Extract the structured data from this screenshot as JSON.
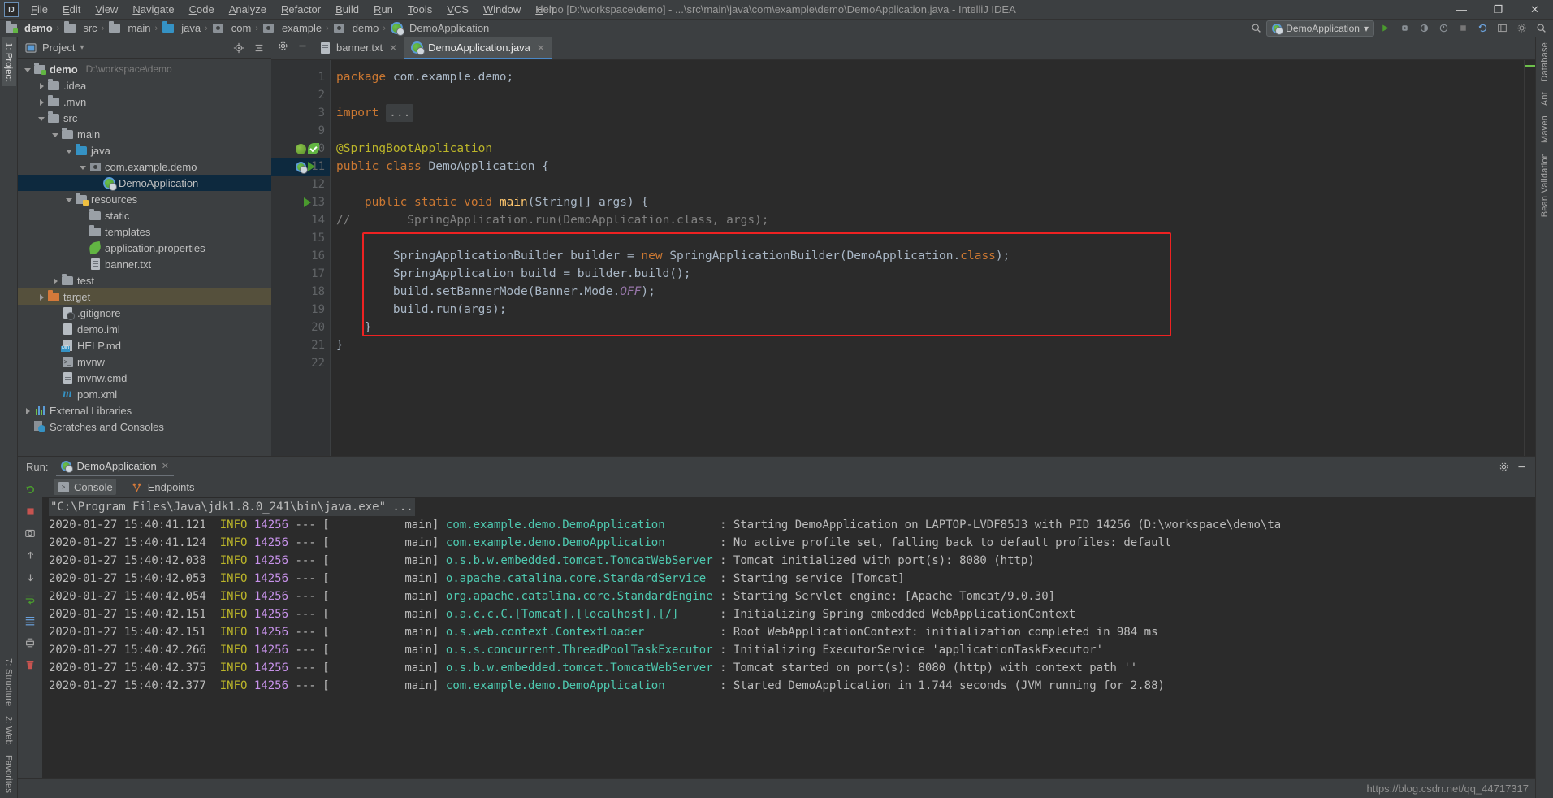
{
  "window": {
    "title": "demo [D:\\workspace\\demo] - ...\\src\\main\\java\\com\\example\\demo\\DemoApplication.java - IntelliJ IDEA",
    "logo": "IJ",
    "minimize": "—",
    "maximize": "❐",
    "close": "✕"
  },
  "menu": [
    {
      "label": "File"
    },
    {
      "label": "Edit"
    },
    {
      "label": "View"
    },
    {
      "label": "Navigate"
    },
    {
      "label": "Code"
    },
    {
      "label": "Analyze"
    },
    {
      "label": "Refactor"
    },
    {
      "label": "Build"
    },
    {
      "label": "Run"
    },
    {
      "label": "Tools"
    },
    {
      "label": "VCS"
    },
    {
      "label": "Window"
    },
    {
      "label": "Help"
    }
  ],
  "breadcrumb": {
    "separator": "›",
    "items": [
      {
        "label": "demo",
        "icon": "module-folder-icon"
      },
      {
        "label": "src",
        "icon": "folder-icon"
      },
      {
        "label": "main",
        "icon": "folder-icon"
      },
      {
        "label": "java",
        "icon": "source-folder-icon"
      },
      {
        "label": "com",
        "icon": "package-icon"
      },
      {
        "label": "example",
        "icon": "package-icon"
      },
      {
        "label": "demo",
        "icon": "package-icon"
      },
      {
        "label": "DemoApplication",
        "icon": "spring-class-icon"
      }
    ]
  },
  "toolbar": {
    "run_configuration": "DemoApplication",
    "dropdown_caret": "▾",
    "buttons": [
      {
        "name": "hammer-build-icon",
        "glyph": "⚒"
      },
      {
        "name": "run-icon",
        "glyph": "▶"
      },
      {
        "name": "debug-icon",
        "glyph": "⚙"
      },
      {
        "name": "run-coverage-icon",
        "glyph": "◐"
      },
      {
        "name": "profiler-icon",
        "glyph": "◴"
      },
      {
        "name": "stop-icon",
        "glyph": "■"
      },
      {
        "name": "search-everywhere-icon",
        "glyph": "⌕"
      },
      {
        "name": "update-project-icon",
        "glyph": "↻"
      },
      {
        "name": "settings-icon",
        "glyph": "⚙"
      },
      {
        "name": "layout-icon",
        "glyph": "▣"
      }
    ]
  },
  "project_pane": {
    "title": "Project",
    "caret": "▾",
    "tools": [
      {
        "name": "locate-in-tree-icon",
        "glyph": "⊕"
      },
      {
        "name": "collapse-all-icon",
        "glyph": "≡"
      },
      {
        "name": "settings-gear-icon",
        "glyph": "⚙"
      },
      {
        "name": "hide-panel-icon",
        "glyph": "—"
      }
    ],
    "tree": [
      {
        "label": "demo",
        "sub": "D:\\workspace\\demo",
        "indent": 0,
        "arrow": "down",
        "icon": "module-folder-icon",
        "bold": true,
        "state": "normal"
      },
      {
        "label": ".idea",
        "sub": "",
        "indent": 1,
        "arrow": "right",
        "icon": "folder-icon",
        "bold": false,
        "state": "normal"
      },
      {
        "label": ".mvn",
        "sub": "",
        "indent": 1,
        "arrow": "right",
        "icon": "folder-icon",
        "bold": false,
        "state": "normal"
      },
      {
        "label": "src",
        "sub": "",
        "indent": 1,
        "arrow": "down",
        "icon": "folder-icon",
        "bold": false,
        "state": "normal"
      },
      {
        "label": "main",
        "sub": "",
        "indent": 2,
        "arrow": "down",
        "icon": "folder-icon",
        "bold": false,
        "state": "normal"
      },
      {
        "label": "java",
        "sub": "",
        "indent": 3,
        "arrow": "down",
        "icon": "source-folder-icon",
        "bold": false,
        "state": "normal"
      },
      {
        "label": "com.example.demo",
        "sub": "",
        "indent": 4,
        "arrow": "down",
        "icon": "package-icon",
        "bold": false,
        "state": "normal"
      },
      {
        "label": "DemoApplication",
        "sub": "",
        "indent": 5,
        "arrow": "none",
        "icon": "spring-class-icon",
        "bold": false,
        "state": "selected"
      },
      {
        "label": "resources",
        "sub": "",
        "indent": 3,
        "arrow": "down",
        "icon": "resources-folder-icon",
        "bold": false,
        "state": "normal"
      },
      {
        "label": "static",
        "sub": "",
        "indent": 4,
        "arrow": "none",
        "icon": "folder-icon",
        "bold": false,
        "state": "normal"
      },
      {
        "label": "templates",
        "sub": "",
        "indent": 4,
        "arrow": "none",
        "icon": "folder-icon",
        "bold": false,
        "state": "normal"
      },
      {
        "label": "application.properties",
        "sub": "",
        "indent": 4,
        "arrow": "none",
        "icon": "spring-properties-icon",
        "bold": false,
        "state": "normal"
      },
      {
        "label": "banner.txt",
        "sub": "",
        "indent": 4,
        "arrow": "none",
        "icon": "text-file-icon",
        "bold": false,
        "state": "normal"
      },
      {
        "label": "test",
        "sub": "",
        "indent": 2,
        "arrow": "right",
        "icon": "folder-icon",
        "bold": false,
        "state": "normal"
      },
      {
        "label": "target",
        "sub": "",
        "indent": 1,
        "arrow": "right",
        "icon": "excluded-folder-icon",
        "bold": false,
        "state": "highlight"
      },
      {
        "label": ".gitignore",
        "sub": "",
        "indent": 2,
        "arrow": "none",
        "icon": "gitignore-file-icon",
        "bold": false,
        "state": "normal"
      },
      {
        "label": "demo.iml",
        "sub": "",
        "indent": 2,
        "arrow": "none",
        "icon": "iml-file-icon",
        "bold": false,
        "state": "normal"
      },
      {
        "label": "HELP.md",
        "sub": "",
        "indent": 2,
        "arrow": "none",
        "icon": "markdown-file-icon",
        "bold": false,
        "state": "normal"
      },
      {
        "label": "mvnw",
        "sub": "",
        "indent": 2,
        "arrow": "none",
        "icon": "shell-script-icon",
        "bold": false,
        "state": "normal"
      },
      {
        "label": "mvnw.cmd",
        "sub": "",
        "indent": 2,
        "arrow": "none",
        "icon": "text-file-icon",
        "bold": false,
        "state": "normal"
      },
      {
        "label": "pom.xml",
        "sub": "",
        "indent": 2,
        "arrow": "none",
        "icon": "maven-pom-icon",
        "bold": false,
        "state": "normal"
      },
      {
        "label": "External Libraries",
        "sub": "",
        "indent": 0,
        "arrow": "right",
        "icon": "libraries-icon",
        "bold": false,
        "state": "normal"
      },
      {
        "label": "Scratches and Consoles",
        "sub": "",
        "indent": 0,
        "arrow": "none",
        "icon": "scratches-icon",
        "bold": false,
        "state": "normal"
      }
    ]
  },
  "editor": {
    "tabs": [
      {
        "label": "banner.txt",
        "icon": "text-file-icon",
        "active": false,
        "close": "✕"
      },
      {
        "label": "DemoApplication.java",
        "icon": "spring-class-icon",
        "active": true,
        "close": "✕"
      }
    ],
    "gutter_tools": {
      "gear": "⚙",
      "minimize": "—"
    },
    "lines": [
      {
        "num": "1",
        "html": "<span class=\"kw\">package</span> com.example.demo;"
      },
      {
        "num": "2",
        "html": ""
      },
      {
        "num": "3",
        "html": "<span class=\"kw\">import</span> <span class=\"fold\">...</span>"
      },
      {
        "num": "9",
        "html": ""
      },
      {
        "num": "10",
        "html": "<span class=\"ann\">@SpringBootApplication</span>"
      },
      {
        "num": "11",
        "html": "<span class=\"kw\">public</span> <span class=\"kw\">class</span> DemoApplication {"
      },
      {
        "num": "12",
        "html": ""
      },
      {
        "num": "13",
        "html": "    <span class=\"kw\">public</span> <span class=\"kw\">static</span> <span class=\"kw\">void</span> <span class=\"mth\">main</span>(String[] args) {"
      },
      {
        "num": "14",
        "html": "<span class=\"cmt\">//        SpringApplication.run(DemoApplication.class, args);</span>"
      },
      {
        "num": "15",
        "html": ""
      },
      {
        "num": "16",
        "html": "        SpringApplicationBuilder builder = <span class=\"kw\">new</span> SpringApplicationBuilder(DemoApplication.<span class=\"kw\">class</span>);"
      },
      {
        "num": "17",
        "html": "        SpringApplication build = builder.build();"
      },
      {
        "num": "18",
        "html": "        build.setBannerMode(Banner.Mode.<span class=\"stc\">OFF</span>);"
      },
      {
        "num": "19",
        "html": "        build.run(args);"
      },
      {
        "num": "20",
        "html": "    }"
      },
      {
        "num": "21",
        "html": "}"
      },
      {
        "num": "22",
        "html": ""
      }
    ],
    "plain_lines": [
      "package com.example.demo;",
      "",
      "import ...",
      "",
      "@SpringBootApplication",
      "public class DemoApplication {",
      "",
      "    public static void main(String[] args) {",
      "//        SpringApplication.run(DemoApplication.class, args);",
      "",
      "        SpringApplicationBuilder builder = new SpringApplicationBuilder(DemoApplication.class);",
      "        SpringApplication build = builder.build();",
      "        build.setBannerMode(Banner.Mode.OFF);",
      "        build.run(args);",
      "    }",
      "}",
      ""
    ],
    "highlight_color": "#ee2222"
  },
  "run_panel": {
    "label": "Run:",
    "tab_title": "DemoApplication",
    "tab_close": "✕",
    "settings_icon": "⚙",
    "hide_icon": "—",
    "tabs": [
      {
        "label": "Console",
        "icon": "console-icon",
        "active": true
      },
      {
        "label": "Endpoints",
        "icon": "endpoints-icon",
        "active": false
      }
    ],
    "side_buttons": [
      {
        "name": "rerun-icon",
        "glyph": "↻"
      },
      {
        "name": "stop-icon",
        "glyph": "■"
      },
      {
        "name": "camera-icon",
        "glyph": "◱"
      },
      {
        "name": "up-icon",
        "glyph": "↑"
      },
      {
        "name": "down-icon",
        "glyph": "↓"
      },
      {
        "name": "soft-wrap-icon",
        "glyph": "↵"
      },
      {
        "name": "scroll-to-end-icon",
        "glyph": "↧"
      },
      {
        "name": "print-icon",
        "glyph": "⎙"
      },
      {
        "name": "clear-all-icon",
        "glyph": "🗑"
      }
    ],
    "command_line": "\"C:\\Program Files\\Java\\jdk1.8.0_241\\bin\\java.exe\" ...",
    "log": [
      {
        "date": "2020-01-27 15:40:41.121",
        "level": "INFO",
        "pid": "14256",
        "sep": "---",
        "thread": "main",
        "logger": "com.example.demo.DemoApplication",
        "message": "Starting DemoApplication on LAPTOP-LVDF85J3 with PID 14256 (D:\\workspace\\demo\\ta"
      },
      {
        "date": "2020-01-27 15:40:41.124",
        "level": "INFO",
        "pid": "14256",
        "sep": "---",
        "thread": "main",
        "logger": "com.example.demo.DemoApplication",
        "message": "No active profile set, falling back to default profiles: default"
      },
      {
        "date": "2020-01-27 15:40:42.038",
        "level": "INFO",
        "pid": "14256",
        "sep": "---",
        "thread": "main",
        "logger": "o.s.b.w.embedded.tomcat.TomcatWebServer",
        "message": "Tomcat initialized with port(s): 8080 (http)"
      },
      {
        "date": "2020-01-27 15:40:42.053",
        "level": "INFO",
        "pid": "14256",
        "sep": "---",
        "thread": "main",
        "logger": "o.apache.catalina.core.StandardService",
        "message": "Starting service [Tomcat]"
      },
      {
        "date": "2020-01-27 15:40:42.054",
        "level": "INFO",
        "pid": "14256",
        "sep": "---",
        "thread": "main",
        "logger": "org.apache.catalina.core.StandardEngine",
        "message": "Starting Servlet engine: [Apache Tomcat/9.0.30]"
      },
      {
        "date": "2020-01-27 15:40:42.151",
        "level": "INFO",
        "pid": "14256",
        "sep": "---",
        "thread": "main",
        "logger": "o.a.c.c.C.[Tomcat].[localhost].[/]",
        "message": "Initializing Spring embedded WebApplicationContext"
      },
      {
        "date": "2020-01-27 15:40:42.151",
        "level": "INFO",
        "pid": "14256",
        "sep": "---",
        "thread": "main",
        "logger": "o.s.web.context.ContextLoader",
        "message": "Root WebApplicationContext: initialization completed in 984 ms"
      },
      {
        "date": "2020-01-27 15:40:42.266",
        "level": "INFO",
        "pid": "14256",
        "sep": "---",
        "thread": "main",
        "logger": "o.s.s.concurrent.ThreadPoolTaskExecutor",
        "message": "Initializing ExecutorService 'applicationTaskExecutor'"
      },
      {
        "date": "2020-01-27 15:40:42.375",
        "level": "INFO",
        "pid": "14256",
        "sep": "---",
        "thread": "main",
        "logger": "o.s.b.w.embedded.tomcat.TomcatWebServer",
        "message": "Tomcat started on port(s): 8080 (http) with context path ''"
      },
      {
        "date": "2020-01-27 15:40:42.377",
        "level": "INFO",
        "pid": "14256",
        "sep": "---",
        "thread": "main",
        "logger": "com.example.demo.DemoApplication",
        "message": "Started DemoApplication in 1.744 seconds (JVM running for 2.88)"
      }
    ]
  },
  "rails": {
    "left_top": [
      "1: Project"
    ],
    "left_bottom": [
      "7: Structure",
      "2: Web",
      "Favorites"
    ],
    "right": [
      "Database",
      "Ant",
      "Maven",
      "Bean Validation"
    ]
  },
  "status_bar": {
    "watermark": "https://blog.csdn.net/qq_44717317"
  },
  "colors": {
    "accent": "#4a88c7",
    "selection": "#0d293e",
    "highlight_box": "#ee2222",
    "editor_bg": "#2b2b2b",
    "chrome_bg": "#3c3f41"
  }
}
